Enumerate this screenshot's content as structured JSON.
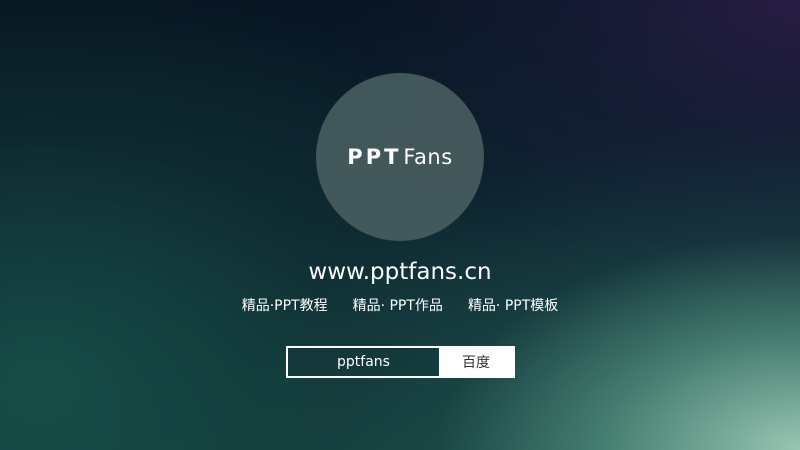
{
  "logo": {
    "text_ppt": "PPT",
    "text_fans": "Fans"
  },
  "site": {
    "url": "www.pptfans.cn"
  },
  "taglines": [
    "精品·PPT教程",
    "精品· PPT作品",
    "精品· PPT模板"
  ],
  "search": {
    "value": "pptfans",
    "button_label": "百度"
  },
  "colors": {
    "text": "#ffffff",
    "logo_circle": "#485c5e",
    "search_button_bg": "#ffffff"
  }
}
